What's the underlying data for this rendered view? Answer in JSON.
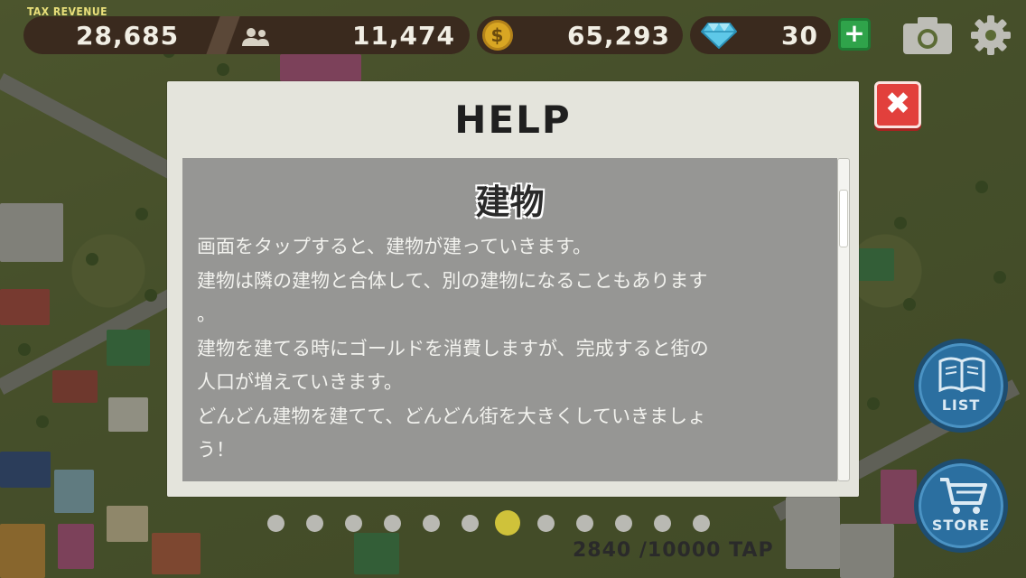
{
  "hud": {
    "tax_revenue_label": "TAX REVENUE",
    "tax_revenue": "28,685",
    "population": "11,474",
    "gold": "65,293",
    "gems": "30",
    "coin_symbol": "$",
    "plus_label": "+"
  },
  "dialog": {
    "title": "HELP",
    "section_title": "建物",
    "body": "画面をタップすると、建物が建っていきます。\n建物は隣の建物と合体して、別の建物になることもあります\n。\n建物を建てる時にゴールドを消費しますが、完成すると街の\n人口が増えていきます。\nどんどん建物を建てて、どんどん街を大きくしていきましょ\nう！",
    "close_label": "✖"
  },
  "side_buttons": {
    "list_label": "LIST",
    "store_label": "STORE"
  },
  "footer": {
    "tap_counter": "2840 /10000 TAP",
    "page_dots": 12,
    "active_dot": 6
  },
  "colors": {
    "hud_bg": "#3a2a1e",
    "close_red": "#e2403c",
    "plus_green": "#2fa34a",
    "round_btn_blue": "#2b6fa0",
    "active_dot": "#cfc23a"
  },
  "icons": {
    "population": "people-icon",
    "gold": "coin-icon",
    "gems": "diamond-icon",
    "camera": "camera-icon",
    "settings": "gear-icon",
    "list": "book-icon",
    "store": "cart-icon"
  }
}
